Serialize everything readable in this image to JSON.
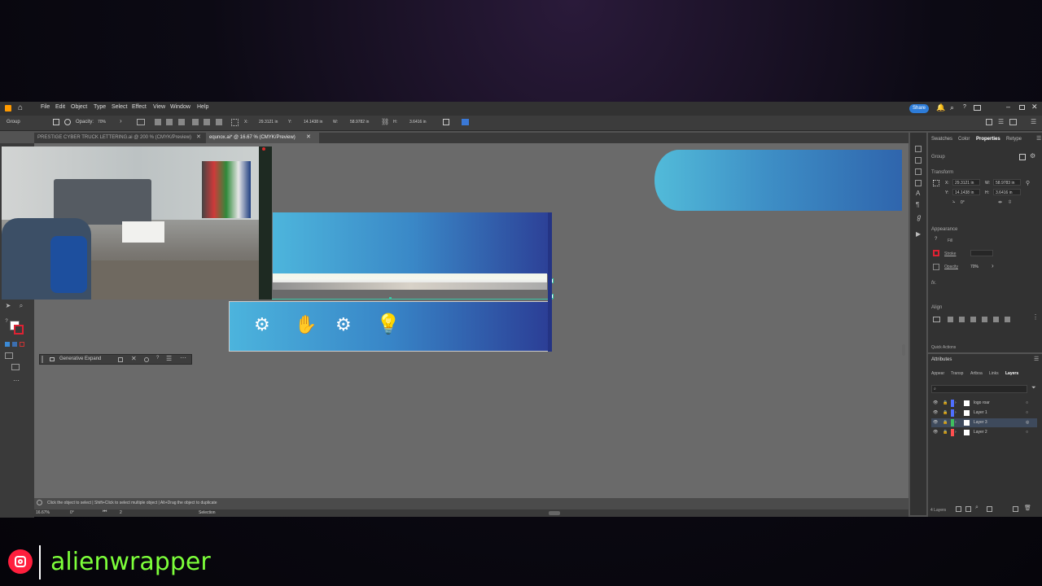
{
  "menubar": {
    "items": [
      "File",
      "Edit",
      "Object",
      "Type",
      "Select",
      "Effect",
      "View",
      "Window",
      "Help"
    ],
    "share_label": "Share"
  },
  "controlbar": {
    "selection_label": "Group",
    "opacity_label": "Opacity:",
    "opacity_value": "70%",
    "x_label": "X:",
    "x_value": "29.3121 in",
    "y_label": "Y:",
    "y_value": "14.1438 in",
    "w_label": "W:",
    "w_value": "58.9782 in",
    "h_label": "H:",
    "h_value": "3.6416 in"
  },
  "doctabs": [
    {
      "label": "PRESTIGE CYBER TRUCK LETTERING.ai @ 200 % (CMYK/Preview)",
      "active": false
    },
    {
      "label": "equnox.ai* @ 16.67 % (CMYK/Preview)",
      "active": true
    }
  ],
  "contextbar": {
    "generative_label": "Generative Expand"
  },
  "statusbar": {
    "hint_text": "Click the object to select | Shift+Click to select multiple object | Alt+Drag the object to duplicate",
    "zoom_value": "16.67%",
    "rotation_value": "0°",
    "artboard_value": "2",
    "tool_label": "Selection"
  },
  "properties": {
    "tabs": [
      "Swatches",
      "Color",
      "Properties",
      "Retype"
    ],
    "active_tab": "Properties",
    "selection_label": "Group",
    "transform_header": "Transform",
    "x_value": "29.3121 in",
    "y_value": "14.1438 in",
    "w_value": "58.9783 in",
    "h_value": "3.6416 in",
    "rotate_value": "0°",
    "appearance_header": "Appearance",
    "fill_label": "Fill",
    "stroke_label": "Stroke",
    "opacity_label": "Opacity",
    "opacity_value": "70%",
    "fx_label": "fx.",
    "align_header": "Align",
    "quick_actions_header": "Quick Actions"
  },
  "layers_panel": {
    "header": "Attributes",
    "tabs": [
      "Appear",
      "Transp",
      "Artboa",
      "Links",
      "Layers"
    ],
    "active_tab": "Layers",
    "layers": [
      {
        "name": "logo roar",
        "color": "#4f6fff",
        "selected": false
      },
      {
        "name": "Layer 1",
        "color": "#4f6fff",
        "selected": false
      },
      {
        "name": "Layer 3",
        "color": "#3fbf5f",
        "selected": true
      },
      {
        "name": "Layer 2",
        "color": "#ff4f4f",
        "selected": false
      }
    ],
    "count_label": "4 Layers"
  },
  "watermark": {
    "handle": "alienwrapper"
  },
  "colors": {
    "accent": "#2d7cd9",
    "banner_light": "#4fb8da",
    "banner_dark": "#2c3f96",
    "handle_green": "#7dff3a"
  }
}
